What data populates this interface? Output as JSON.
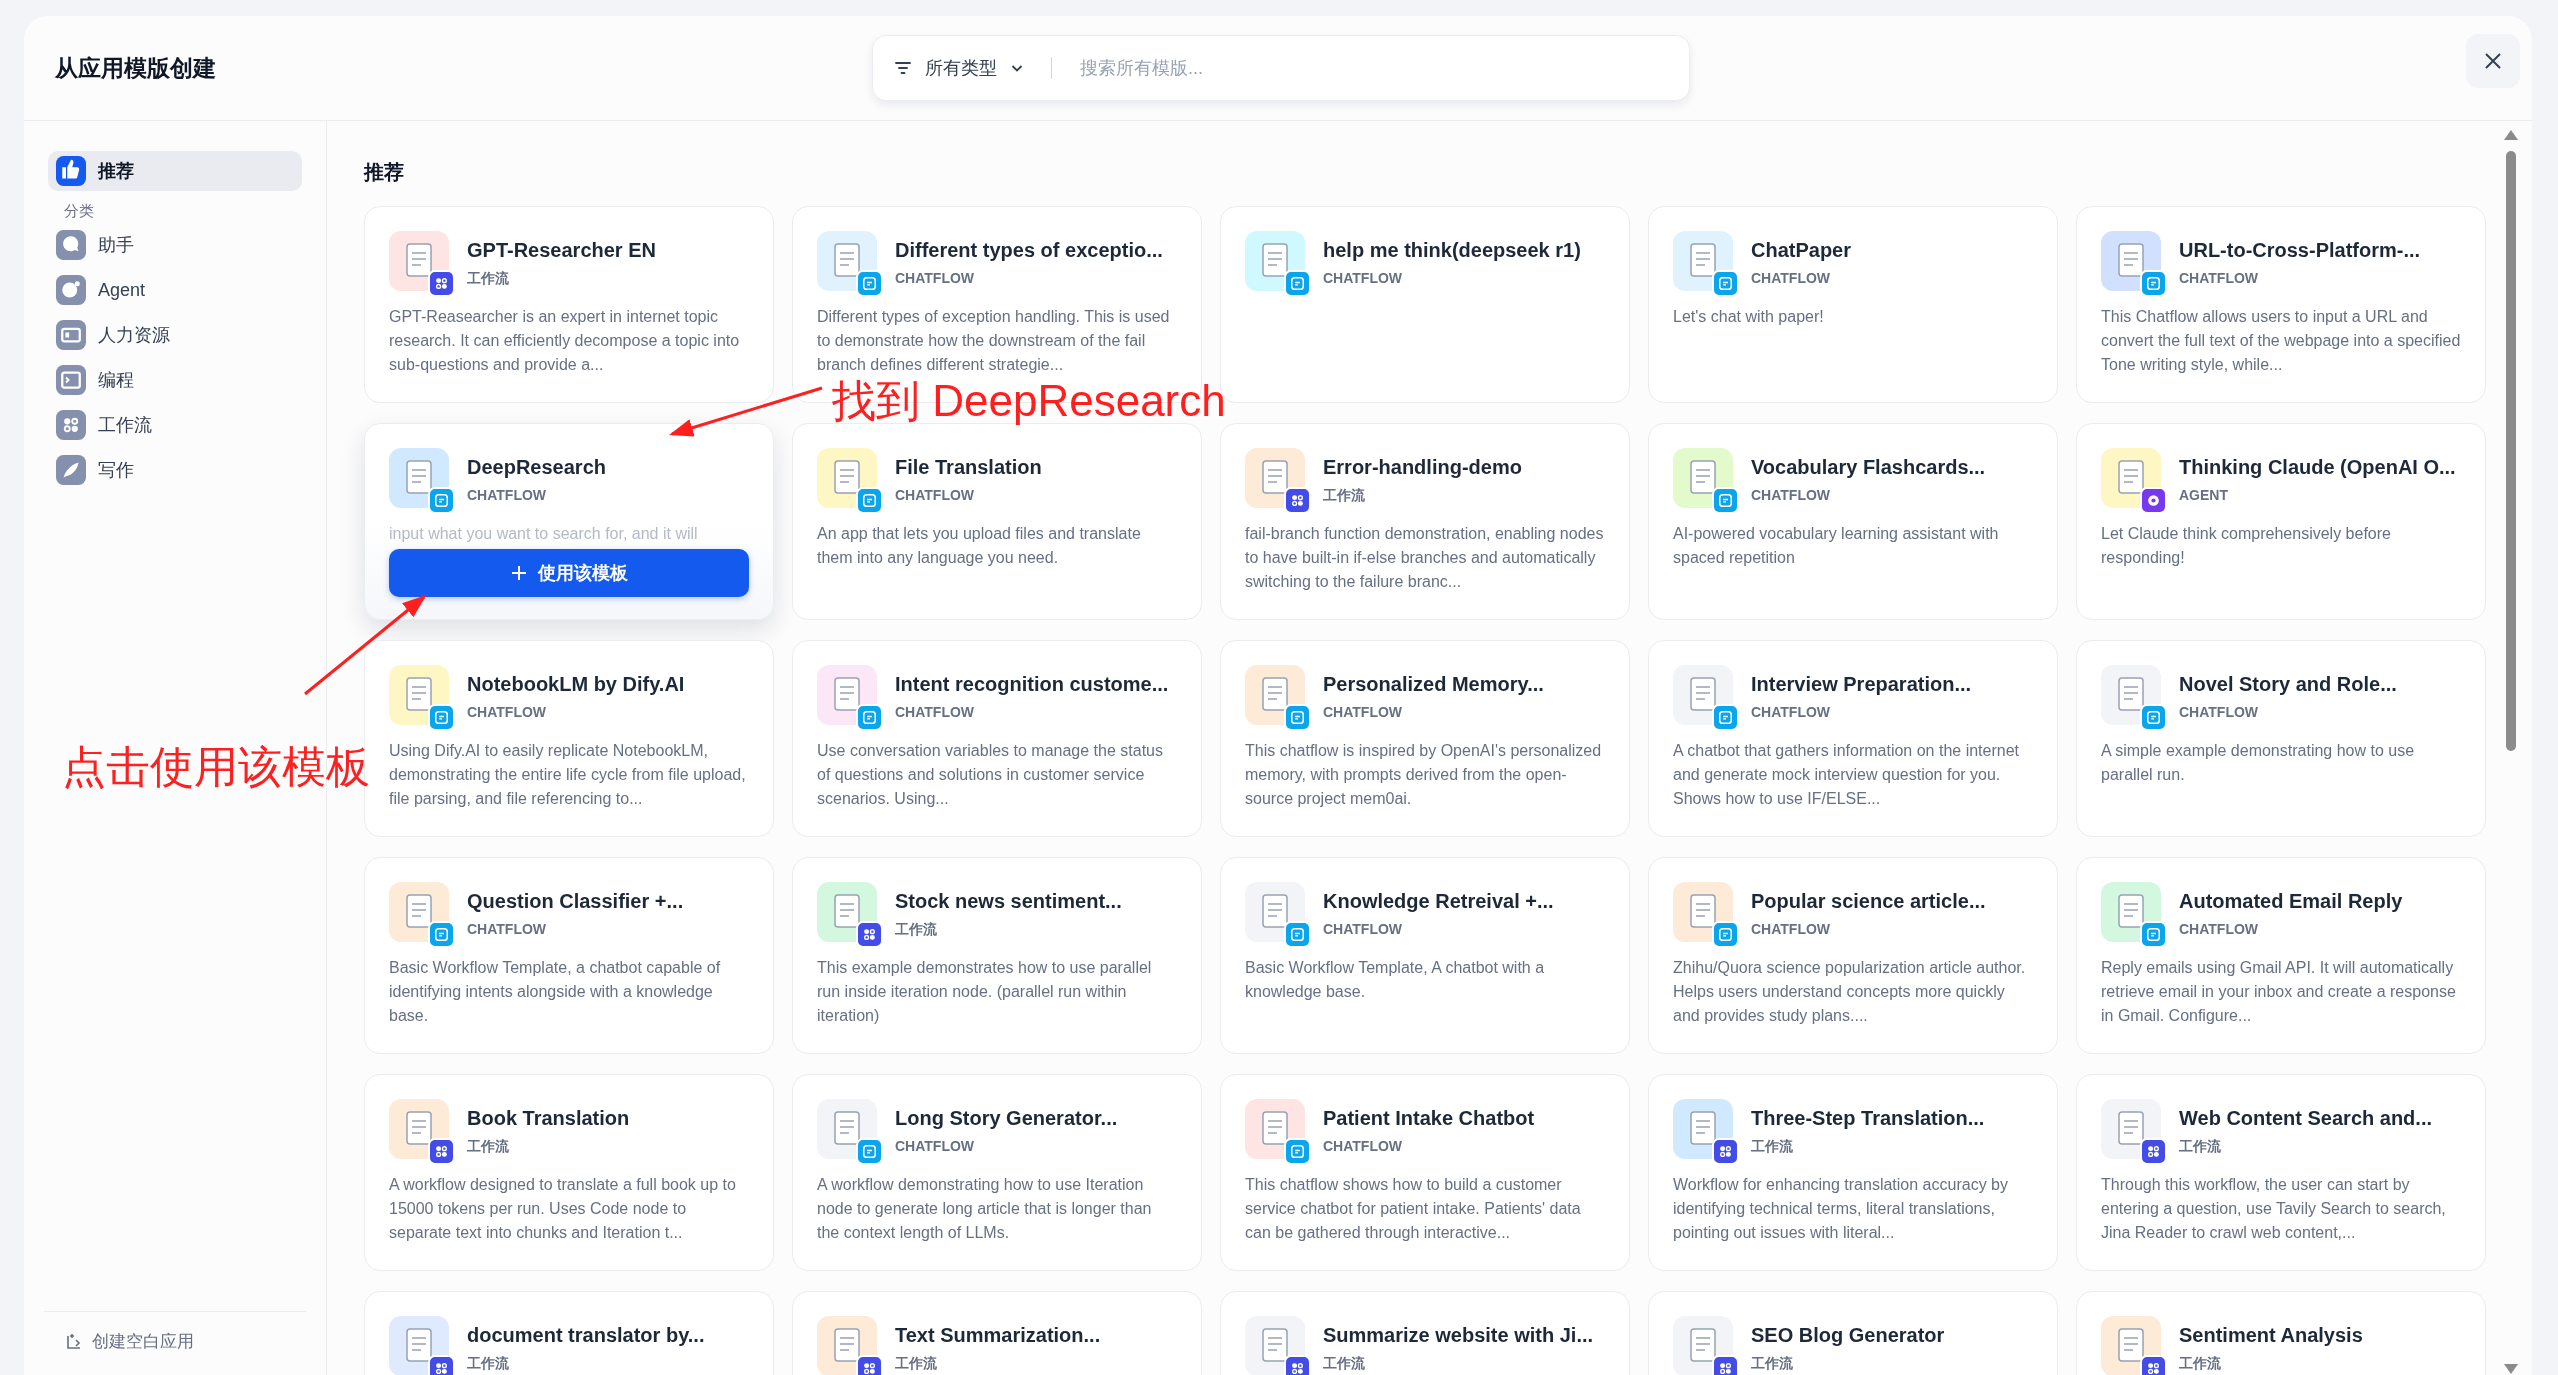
{
  "window": {
    "title": "从应用模版创建"
  },
  "search": {
    "filter_label": "所有类型",
    "placeholder": "搜索所有模版..."
  },
  "sidebar": {
    "items": [
      {
        "label": "推荐",
        "selected": true,
        "kind": "recommend"
      }
    ],
    "category_heading": "分类",
    "categories": [
      {
        "label": "助手",
        "selected": false,
        "kind": "assistant"
      },
      {
        "label": "Agent",
        "selected": false,
        "kind": "agent"
      },
      {
        "label": "人力资源",
        "selected": false,
        "kind": "hr"
      },
      {
        "label": "编程",
        "selected": false,
        "kind": "code"
      },
      {
        "label": "工作流",
        "selected": false,
        "kind": "workflow"
      },
      {
        "label": "写作",
        "selected": false,
        "kind": "writing"
      }
    ],
    "create_blank": "创建空白应用"
  },
  "section_title": "推荐",
  "cards": [
    {
      "name": "GPT-Researcher EN",
      "type": "工作流",
      "kind": "workflow",
      "color": "#fee4e2",
      "description": "GPT-Reasearcher is an expert in internet topic research. It can efficiently decompose a topic into sub-questions and provide a...",
      "hovered": false
    },
    {
      "name": "Different types of exceptio...",
      "type": "CHATFLOW",
      "kind": "chatflow",
      "color": "#e0f2fe",
      "description": "Different types of exception handling. This is used to demonstrate how the downstream of the fail branch defines different strategie...",
      "hovered": false
    },
    {
      "name": "help me think(deepseek r1)",
      "type": "CHATFLOW",
      "kind": "chatflow",
      "color": "#cff9fe",
      "hovered": false
    },
    {
      "name": "ChatPaper",
      "type": "CHATFLOW",
      "kind": "chatflow",
      "color": "#e0f2fe",
      "description": "Let's chat with paper!",
      "hovered": false
    },
    {
      "name": "URL-to-Cross-Platform-...",
      "type": "CHATFLOW",
      "kind": "chatflow",
      "color": "#d1e0ff",
      "description": "This Chatflow allows users to input a URL and convert the full text of the webpage into a specified Tone writing style, while...",
      "hovered": false
    },
    {
      "name": "DeepResearch",
      "type": "CHATFLOW",
      "kind": "chatflow",
      "color": "#d1e9ff",
      "description": "input what you want to search for, and it will",
      "hovered": true,
      "action_label": "使用该模板"
    },
    {
      "name": "File Translation",
      "type": "CHATFLOW",
      "kind": "chatflow",
      "color": "#fef7c3",
      "description": "An app that lets you upload files and translate them into any language you need.",
      "hovered": false
    },
    {
      "name": "Error-handling-demo",
      "type": "工作流",
      "kind": "workflow",
      "color": "#fdead7",
      "description": "fail-branch function demonstration, enabling nodes to have built-in if-else branches and automatically switching to the failure branc...",
      "hovered": false
    },
    {
      "name": "Vocabulary Flashcards...",
      "type": "CHATFLOW",
      "kind": "chatflow",
      "color": "#e3fbcc",
      "description": "AI-powered vocabulary learning assistant with spaced repetition",
      "hovered": false
    },
    {
      "name": "Thinking Claude (OpenAI O...",
      "type": "AGENT",
      "kind": "agent",
      "color": "#fef7c3",
      "description": "Let Claude think comprehensively before responding!",
      "hovered": false
    },
    {
      "name": "NotebookLM by Dify.AI",
      "type": "CHATFLOW",
      "kind": "chatflow",
      "color": "#fef7c3",
      "description": "Using Dify.AI to easily replicate NotebookLM, demonstrating the entire life cycle from file upload, file parsing, and file referencing to...",
      "hovered": false
    },
    {
      "name": "Intent recognition custome...",
      "type": "CHATFLOW",
      "kind": "chatflow",
      "color": "#fce7f6",
      "description": "Use conversation variables to manage the status of questions and solutions in customer service scenarios. Using...",
      "hovered": false
    },
    {
      "name": "Personalized Memory...",
      "type": "CHATFLOW",
      "kind": "chatflow",
      "color": "#fdead7",
      "description": "This chatflow is inspired by OpenAI's personalized memory, with prompts derived from the open-source project mem0ai.",
      "hovered": false
    },
    {
      "name": "Interview Preparation...",
      "type": "CHATFLOW",
      "kind": "chatflow",
      "color": "#f2f4f7",
      "description": "A chatbot that gathers information on the internet and generate mock interview question for you. Shows how to use IF/ELSE...",
      "hovered": false
    },
    {
      "name": "Novel Story and Role...",
      "type": "CHATFLOW",
      "kind": "chatflow",
      "color": "#f2f4f7",
      "description": "A simple example demonstrating how to use parallel run.",
      "hovered": false
    },
    {
      "name": "Question Classifier +...",
      "type": "CHATFLOW",
      "kind": "chatflow",
      "color": "#fdead7",
      "description": "Basic Workflow Template, a chatbot capable of identifying intents alongside with a knowledge base.",
      "hovered": false
    },
    {
      "name": "Stock news sentiment...",
      "type": "工作流",
      "kind": "workflow",
      "color": "#d3f8df",
      "description": "This example demonstrates how to use parallel run inside iteration node. (parallel run within iteration)",
      "hovered": false
    },
    {
      "name": "Knowledge Retreival +...",
      "type": "CHATFLOW",
      "kind": "chatflow",
      "color": "#f2f4f7",
      "description": "Basic Workflow Template, A chatbot with a knowledge base.",
      "hovered": false
    },
    {
      "name": "Popular science article...",
      "type": "CHATFLOW",
      "kind": "chatflow",
      "color": "#fdead7",
      "description": "Zhihu/Quora science popularization article author. Helps users understand concepts more quickly and provides study plans....",
      "hovered": false
    },
    {
      "name": "Automated Email Reply",
      "type": "CHATFLOW",
      "kind": "chatflow",
      "color": "#d3f8df",
      "description": "Reply emails using Gmail API. It will automatically retrieve email in your inbox and create a response in Gmail. Configure...",
      "hovered": false
    },
    {
      "name": "Book Translation",
      "type": "工作流",
      "kind": "workflow",
      "color": "#fdead7",
      "description": "A workflow designed to translate a full book up to 15000 tokens per run. Uses Code node to separate text into chunks and Iteration t...",
      "hovered": false
    },
    {
      "name": "Long Story Generator...",
      "type": "CHATFLOW",
      "kind": "chatflow",
      "color": "#f2f4f7",
      "description": "A workflow demonstrating how to use Iteration node to generate long article that is longer than the context length of LLMs.",
      "hovered": false
    },
    {
      "name": "Patient Intake Chatbot",
      "type": "CHATFLOW",
      "kind": "chatflow",
      "color": "#fee4e2",
      "description": "This chatflow shows how to build a customer service chatbot for patient intake. Patients' data can be gathered through interactive...",
      "hovered": false
    },
    {
      "name": "Three-Step Translation...",
      "type": "工作流",
      "kind": "workflow",
      "color": "#d1e9ff",
      "description": "Workflow for enhancing translation accuracy by identifying technical terms, literal translations, pointing out issues with literal...",
      "hovered": false
    },
    {
      "name": "Web Content Search and...",
      "type": "工作流",
      "kind": "workflow",
      "color": "#f2f4f7",
      "description": "Through this workflow, the user can start by entering a question, use Tavily Search to search, Jina Reader to crawl web content,...",
      "hovered": false
    },
    {
      "name": "document translator by...",
      "type": "工作流",
      "kind": "workflow",
      "color": "#e0eaff",
      "hovered": false
    },
    {
      "name": "Text Summarization...",
      "type": "工作流",
      "kind": "workflow",
      "color": "#fdead7",
      "hovered": false
    },
    {
      "name": "Summarize website with Ji...",
      "type": "工作流",
      "kind": "workflow",
      "color": "#f2f4f7",
      "hovered": false
    },
    {
      "name": "SEO Blog Generator",
      "type": "工作流",
      "kind": "workflow",
      "color": "#f2f4f7",
      "hovered": false
    },
    {
      "name": "Sentiment Analysis",
      "type": "工作流",
      "kind": "workflow",
      "color": "#fdead7",
      "hovered": false
    }
  ],
  "annotations": [
    {
      "text": "找到 DeepResearch"
    },
    {
      "text": "点击使用该模板"
    }
  ]
}
